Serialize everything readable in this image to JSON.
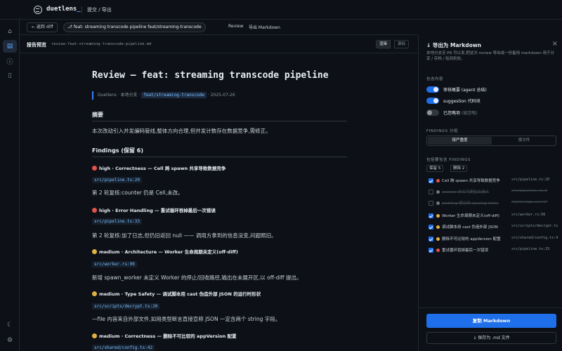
{
  "app": {
    "brand": "duetlens",
    "crumb": "提交 / 导出"
  },
  "toolbar": {
    "back_label": "← 返回 diff",
    "branch_pill": "⎇ feat: streaming transcode pipeline  feat/streaming-transcode",
    "review_label": "Review",
    "export_label": "导出 Markdown"
  },
  "preview": {
    "title": "报告预览",
    "filename": "review-feat-streaming-transcode-pipeline.md",
    "tab_render": "渲染",
    "tab_source": "源码"
  },
  "doc": {
    "title": "Review — feat: streaming transcode pipeline",
    "meta_author": "Duetlens",
    "meta_branch_label": "· 本地分支 ·",
    "meta_branch": "feat/streaming-transcode",
    "meta_date": "· 2025-07-26",
    "summary_heading": "摘要",
    "summary_text": "本次改动引入并发编码管线,整体方向合理,但并发计数存在数据竞争,需修正。",
    "findings_heading": "Findings (保留 6)",
    "findings": [
      {
        "severity": "red",
        "head": "high · Correctness — Cell 跨 spawn 共享导致数据竞争",
        "file": "src/pipeline.ts:20",
        "body": "第 2 轮复核:counter 仍是 Cell,未改。"
      },
      {
        "severity": "red",
        "head": "high · Error Handling — 重试循环吞掉最后一次错误",
        "file": "src/pipeline.ts:33",
        "body": "第 2 轮复核:加了日志,但仍旧返回 null —— 调用方拿到的信息没变,问题照旧。"
      },
      {
        "severity": "yellow",
        "head": "medium · Architecture — Worker 生命周期未定义(off-diff)",
        "file": "src/worker.rs:99",
        "body": "新增 spawn_worker 未定义 Worker 的停止/回收路径,输出在未展开区,以 off-diff 提出。"
      },
      {
        "severity": "yellow",
        "head": "medium · Type Safety — 调试脚本用 cast 伪造外部 JSON 的运行时形状",
        "file": "src/scripts/decrypt.ts:20",
        "body": "—file 内容来自外部文件,如用类型断言直接宣称 JSON 一定含两个 string 字段。"
      },
      {
        "severity": "yellow",
        "head": "medium · Correctness — 删除不可比较的 appVersion 配置",
        "file": "src/shared/config.ts:42",
        "body": ""
      }
    ]
  },
  "panel": {
    "title": "↓ 导出为 Markdown",
    "close": "×",
    "desc": "本地分支无 PR 可以发,把这次 review 导出成一份备用 markdown 用于分享 / 存档 / 贴到别处。",
    "include_label": "包含内容",
    "toggles": [
      {
        "label": "审核概要 (agent 总结)",
        "on": true
      },
      {
        "label": "suggestion 代码块",
        "on": true
      },
      {
        "label": "已忽略项",
        "suffix": "(被忽略)",
        "on": false
      }
    ],
    "findings_section": "FINDINGS 分组",
    "group_by_severity": "按严重度",
    "group_by_file": "按文件",
    "include_findings_label": "包括要包含 FINDINGS",
    "keep_badge": "保留 5",
    "drop_badge": "删除 2",
    "list": [
      {
        "checked": true,
        "dot": "#e5534b",
        "title": "Cell 跨 spawn 共享导致数据竞争",
        "file": "src/pipeline.ts:20",
        "struck": false
      },
      {
        "checked": false,
        "dot": "#6e7681",
        "title": "counter 命名可更贴合语义",
        "file": "src/pipeline.ts:5",
        "struck": true
      },
      {
        "checked": false,
        "dot": "#6e7681",
        "title": "padding 建议用 spacing token",
        "file": "styles/app.css:14",
        "struck": true
      },
      {
        "checked": true,
        "dot": "#e3b341",
        "title": "Worker 生命周期未定义(off-diff)",
        "file": "src/worker.rs:99",
        "struck": false
      },
      {
        "checked": true,
        "dot": "#e3b341",
        "title": "调试脚本用 cast 伪造外部 JSON",
        "file": "src/scripts/decrypt.ts:20",
        "struck": false
      },
      {
        "checked": true,
        "dot": "#e3b341",
        "title": "删除不可比较的 appVersion 配置",
        "file": "src/shared/config.ts:42",
        "struck": false
      },
      {
        "checked": true,
        "dot": "#e5534b",
        "title": "重试循环吞掉最后一次错误",
        "file": "src/pipeline.ts:33",
        "struck": false
      }
    ],
    "copy_label": "复制 Markdown",
    "save_label": "↓ 保存为 .md 文件"
  }
}
